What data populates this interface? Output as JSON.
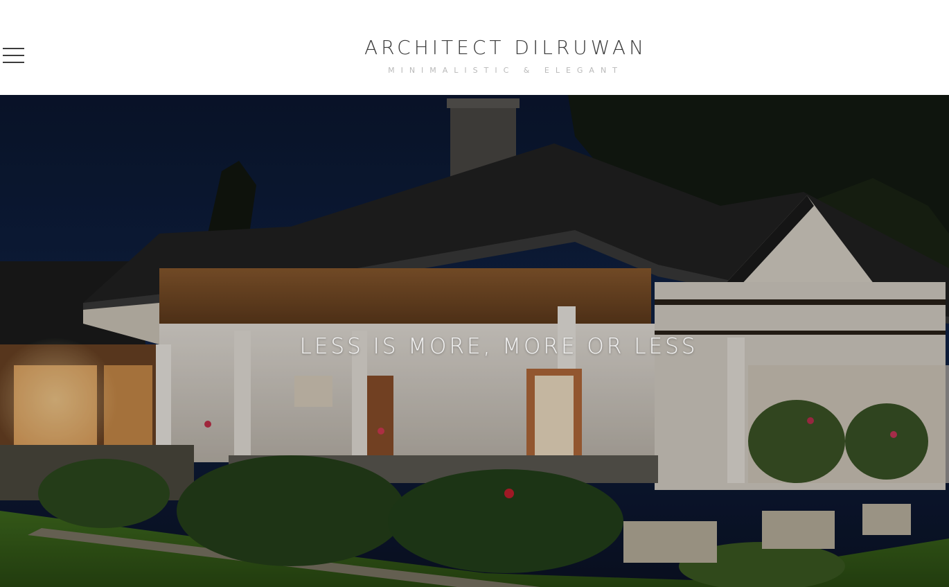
{
  "header": {
    "site_title": "ARCHITECT DILRUWAN",
    "tagline": "MINIMALISTIC & ELEGANT",
    "menu_icon": "hamburger-menu-icon"
  },
  "hero": {
    "heading": "LESS IS MORE, MORE OR LESS",
    "image_description_icon": "hero-image"
  },
  "colors": {
    "title": "#3a3a3a",
    "tagline": "#b9b9b9",
    "hero_text": "#f2f2f2",
    "night_sky": "#0d1a33"
  }
}
